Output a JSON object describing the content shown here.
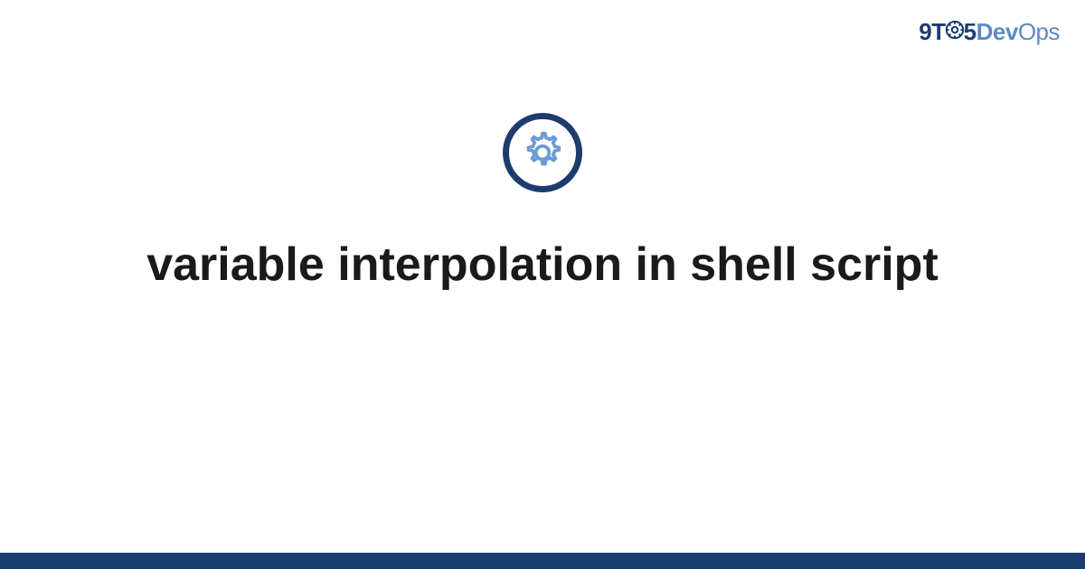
{
  "logo": {
    "part1": "9",
    "part2": "T",
    "part3": "5",
    "part4": "Dev",
    "part5": "Ops"
  },
  "main": {
    "title": "variable interpolation in shell script"
  },
  "colors": {
    "brand_dark": "#1d3c6e",
    "brand_light": "#5b8bc4"
  }
}
